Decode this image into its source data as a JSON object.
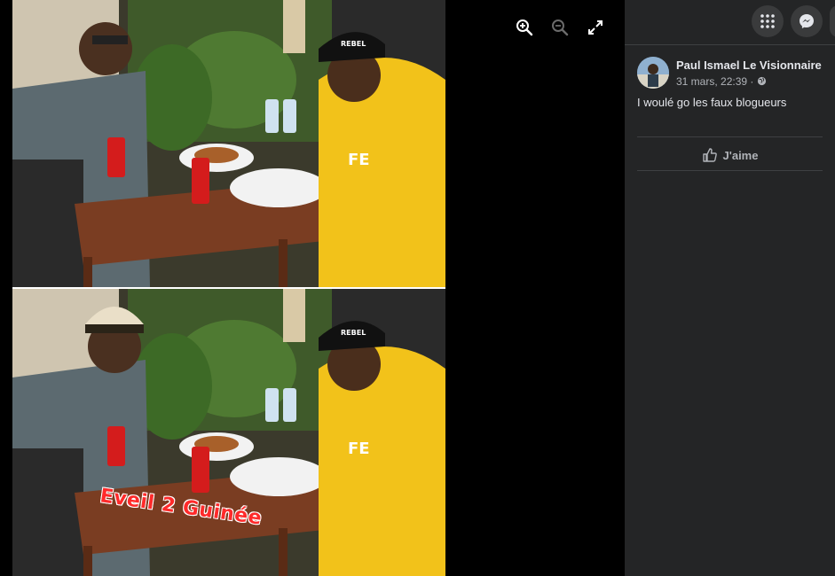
{
  "viewer": {
    "caption": "Eveil 2 Guinée",
    "cap_text": "REBEL",
    "hoodie_text": "FE",
    "tools": [
      {
        "icon": "zoom-in-icon"
      },
      {
        "icon": "zoom-out-icon"
      },
      {
        "icon": "fullscreen-icon"
      }
    ]
  },
  "sidebar": {
    "top_actions": [
      {
        "icon": "apps-grid-icon"
      },
      {
        "icon": "messenger-icon"
      }
    ],
    "post": {
      "author": "Paul Ismael Le Visionnaire",
      "timestamp": "31 mars, 22:39 ·",
      "privacy_icon": "globe-icon",
      "text": "I woulé go les faux blogueurs"
    },
    "actions": {
      "like_label": "J'aime"
    }
  },
  "colors": {
    "sidebar_bg": "#242526",
    "button_bg": "#3a3b3c",
    "text_primary": "#e4e6eb",
    "text_secondary": "#b0b3b8",
    "caption_color": "#ff2a2a",
    "hoodie_yellow": "#f2c21a"
  }
}
